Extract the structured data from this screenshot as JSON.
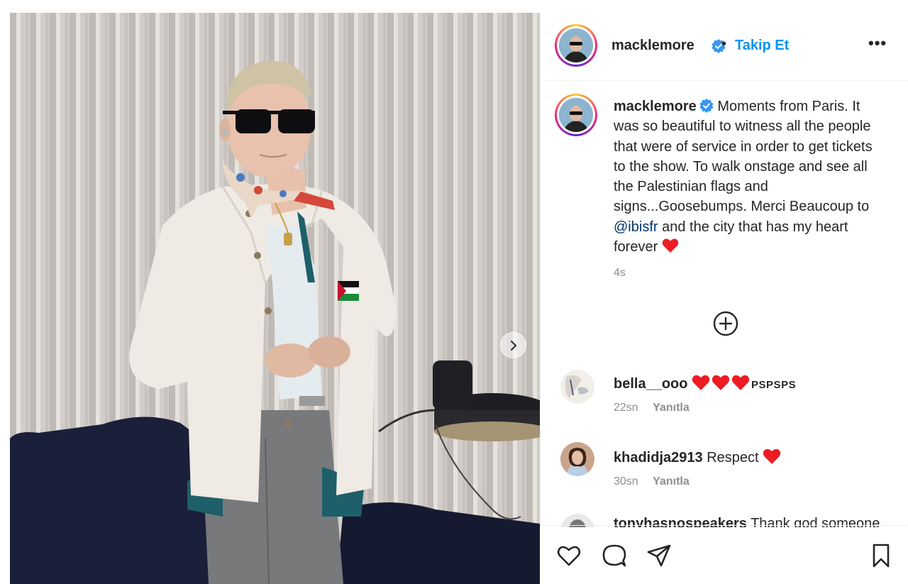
{
  "post": {
    "username": "macklemore",
    "follow_label": "Takip Et",
    "separator": "•",
    "more_label": "•••",
    "caption_parts": {
      "before_mention": "Moments from Paris. It was so beautiful to witness all the people that were of service in order to get tickets to the show. To walk onstage and see all the Palestinian flags and signs...Goosebumps. Merci Beaucoup to ",
      "mention": "@ibisfr",
      "after_mention": " and the city that has my heart forever "
    },
    "caption_time": "4s"
  },
  "comments": [
    {
      "username": "bella__ooo",
      "text": "PSPSPS",
      "hearts": 3,
      "time": "22sn",
      "reply_label": "Yanıtla"
    },
    {
      "username": "khadidja2913",
      "text": "Respect",
      "hearts": 1,
      "time": "30sn",
      "reply_label": "Yanıtla"
    },
    {
      "username": "tonyhasnospeakers",
      "text": "Thank god someone",
      "hearts": 0,
      "time": "",
      "reply_label": ""
    }
  ],
  "icons": {
    "verified": "verified-badge-icon",
    "next": "chevron-right-icon",
    "add": "plus-circle-icon",
    "like": "heart-outline-icon",
    "comment": "speech-bubble-icon",
    "share": "paper-plane-icon",
    "save": "bookmark-icon"
  },
  "colors": {
    "accent": "#0095f6",
    "mention": "#00376b",
    "heart": "#ed1c24",
    "muted": "#8e8e8e",
    "text": "#262626"
  }
}
